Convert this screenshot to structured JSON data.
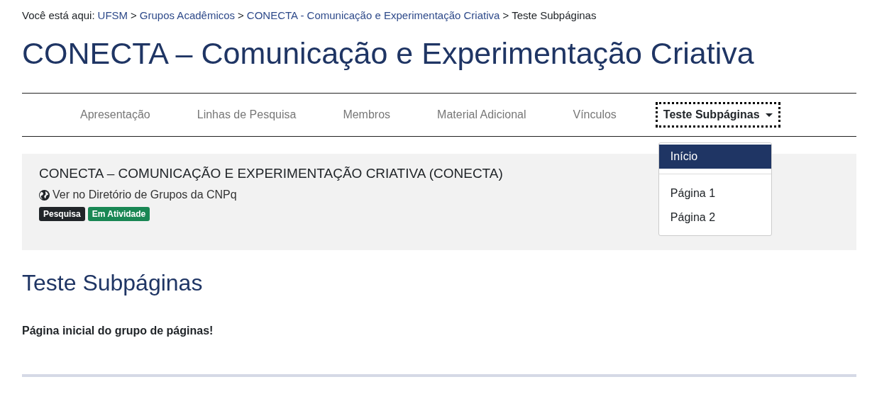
{
  "breadcrumb": {
    "label": "Você está aqui:",
    "separator": ">",
    "items": [
      {
        "text": "UFSM",
        "kind": "link"
      },
      {
        "text": "Grupos Acadêmicos",
        "kind": "link"
      },
      {
        "text": "CONECTA - Comunicação e Experimentação Criativa",
        "kind": "link"
      },
      {
        "text": "Teste Subpáginas",
        "kind": "current"
      }
    ]
  },
  "page_title": "CONECTA – Comunicação e Experimentação Criativa",
  "nav": {
    "tabs": [
      {
        "label": "Apresentação",
        "selected": false,
        "dropdown": false
      },
      {
        "label": "Linhas de Pesquisa",
        "selected": false,
        "dropdown": false
      },
      {
        "label": "Membros",
        "selected": false,
        "dropdown": false
      },
      {
        "label": "Material Adicional",
        "selected": false,
        "dropdown": false
      },
      {
        "label": "Vínculos",
        "selected": false,
        "dropdown": false
      },
      {
        "label": "Teste Subpáginas",
        "selected": true,
        "dropdown": true
      }
    ],
    "menu": [
      {
        "label": "Início",
        "selected": true,
        "kind": "item"
      },
      {
        "kind": "divider"
      },
      {
        "label": "Página 1",
        "selected": false,
        "kind": "item"
      },
      {
        "label": "Página 2",
        "selected": false,
        "kind": "item"
      }
    ]
  },
  "group_card": {
    "name": "CONECTA – COMUNICAÇÃO E EXPERIMENTAÇÃO CRIATIVA (CONECTA)",
    "directory_link": "Ver no Diretório de Grupos da CNPq",
    "tags": [
      {
        "text": "Pesquisa",
        "color": "#212529"
      },
      {
        "text": "Em Atividade",
        "color": "#198754"
      }
    ]
  },
  "section_title": "Teste Subpáginas",
  "body_text": "Página inicial do grupo de páginas!"
}
